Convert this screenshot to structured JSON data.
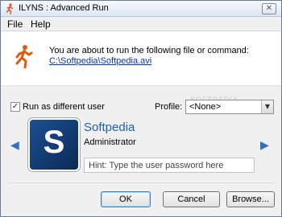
{
  "window": {
    "title": "ILYNS : Advanced Run",
    "close_glyph": "✕"
  },
  "menu": {
    "items": [
      "File",
      "Help"
    ]
  },
  "header": {
    "prompt": "You are about to run the following file or command:",
    "path": "C:\\Softpedia\\Softpedia.avi"
  },
  "options": {
    "run_as_label": "Run as different user",
    "run_as_checked": true,
    "check_glyph": "✓",
    "profile_label": "Profile:",
    "profile_value": "<None>",
    "dropdown_glyph": "▼"
  },
  "user": {
    "avatar_letter": "S",
    "name": "Softpedia",
    "role": "Administrator",
    "password_placeholder": "Hint: Type the user password here",
    "prev_glyph": "◀",
    "next_glyph": "▶"
  },
  "buttons": {
    "ok": "OK",
    "cancel": "Cancel",
    "browse": "Browse..."
  },
  "watermark": "SOFTPEDIA",
  "colors": {
    "accent": "#1c5fb4",
    "link": "#0033cc",
    "runner": "#e05a10"
  }
}
